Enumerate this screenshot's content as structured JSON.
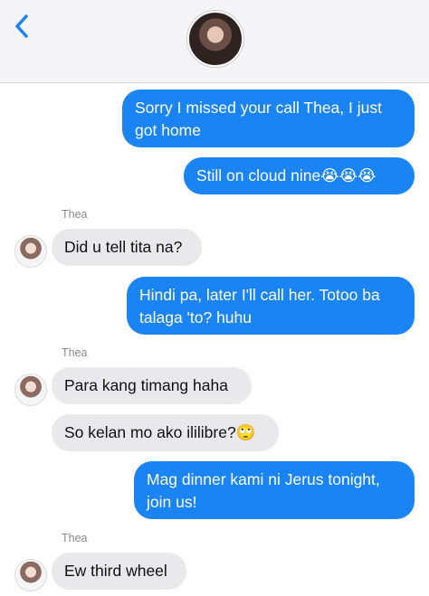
{
  "header": {
    "back_icon": "chevron-left-icon",
    "avatar": "contact-avatar"
  },
  "sender_name": "Thea",
  "messages": [
    {
      "from": "me",
      "text": "Sorry I missed your call Thea, I just got home"
    },
    {
      "from": "me",
      "text": "Still on cloud nine😭😭😭"
    },
    {
      "from": "thea",
      "text": "Did u tell tita na?"
    },
    {
      "from": "me",
      "text": "Hindi pa, later I'll call her. Totoo ba talaga 'to? huhu"
    },
    {
      "from": "thea",
      "text": "Para kang timang haha"
    },
    {
      "from": "thea",
      "text": "So kelan mo ako ililibre?🙄"
    },
    {
      "from": "me",
      "text": "Mag dinner kami ni Jerus tonight, join us!"
    },
    {
      "from": "thea",
      "text": "Ew third wheel"
    }
  ],
  "colors": {
    "outgoing": "#1a84f5",
    "incoming": "#e9e9eb",
    "header": "#f4f4f6"
  }
}
